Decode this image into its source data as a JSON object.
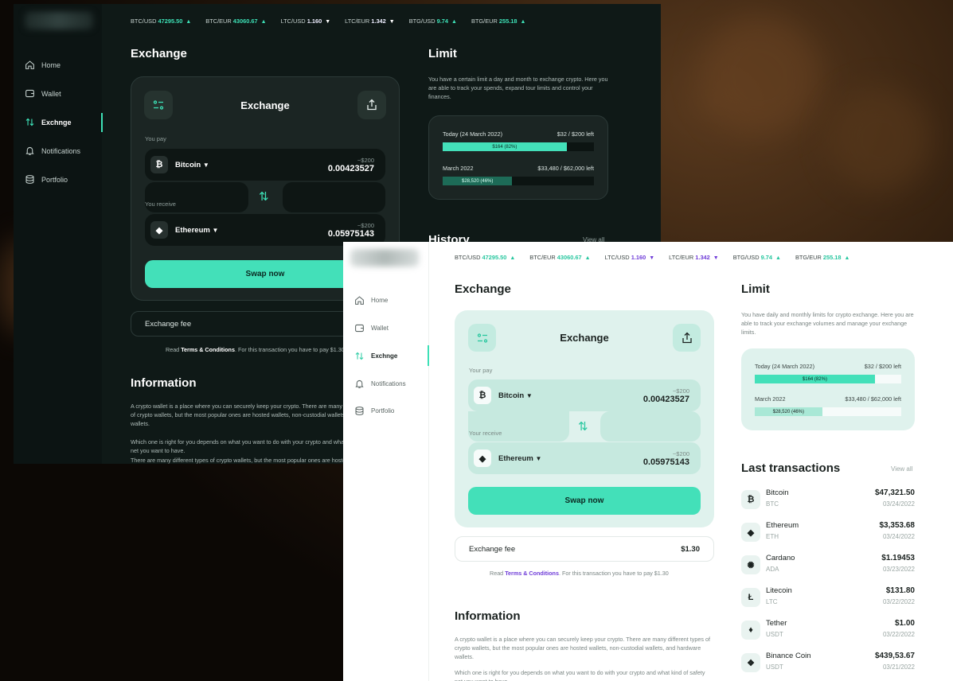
{
  "tickers": [
    {
      "pair": "BTC/USD",
      "value": "47295.50",
      "dir": "up"
    },
    {
      "pair": "BTC/EUR",
      "value": "43060.67",
      "dir": "up"
    },
    {
      "pair": "LTC/USD",
      "value": "1.160",
      "dir": "down"
    },
    {
      "pair": "LTC/EUR",
      "value": "1.342",
      "dir": "down"
    },
    {
      "pair": "BTG/USD",
      "value": "9.74",
      "dir": "up"
    },
    {
      "pair": "BTG/EUR",
      "value": "255.18",
      "dir": "up"
    }
  ],
  "nav": [
    {
      "label": "Home",
      "icon": "home-icon"
    },
    {
      "label": "Wallet",
      "icon": "wallet-icon"
    },
    {
      "label": "Exchnge",
      "icon": "exchange-arrows-icon",
      "active": true
    },
    {
      "label": "Notifications",
      "icon": "bell-icon"
    },
    {
      "label": "Portfolio",
      "icon": "database-icon"
    }
  ],
  "dark": {
    "exchange_heading": "Exchange",
    "card_title": "Exchange",
    "you_pay": "You pay",
    "you_receive": "You receive",
    "pay_coin": "Bitcoin",
    "pay_usd": "~$200",
    "pay_amount": "0.00423527",
    "recv_coin": "Ethereum",
    "recv_usd": "~$200",
    "recv_amount": "0.05975143",
    "swap_label": "Swap now",
    "fee_label": "Exchange fee",
    "terms_prefix": "Read",
    "terms_link": "Terms & Conditions",
    "terms_suffix": ". For this transaction you have to pay $1.30",
    "info_heading": "Information",
    "info_p1": "A crypto wallet is a place where you can securely keep your crypto. There are many different types of crypto wallets, but the most popular ones are hosted wallets, non-custodial wallets, and hardware wallets.",
    "info_p2": "Which one is right for you depends on what you want to do with your crypto and what kind of safety net you want to have.",
    "info_p3": "There are many different types of crypto wallets, but the most popular ones are hosted wallets,",
    "limit_heading": "Limit",
    "limit_text": "You have a certain limit a day and month to exchange crypto. Here you are able to track your spends, expand tour limits and control your finances.",
    "today_label": "Today (24 March 2022)",
    "today_left": "$32 / $200 left",
    "today_bar": "$164 (82%)",
    "today_pct": 0.82,
    "month_label": "March 2022",
    "month_left": "$33,480 / $62,000 left",
    "month_bar": "$28,520 (46%)",
    "month_pct": 0.46,
    "history_heading": "History",
    "history_view_all": "View all"
  },
  "light": {
    "exchange_heading": "Exchange",
    "card_title": "Exchange",
    "you_pay": "Your pay",
    "you_receive": "Your receive",
    "pay_coin": "Bitcoin",
    "pay_usd": "~$200",
    "pay_amount": "0.00423527",
    "recv_coin": "Ethereum",
    "recv_usd": "~$200",
    "recv_amount": "0.05975143",
    "swap_label": "Swap now",
    "fee_label": "Exchange fee",
    "fee_value": "$1.30",
    "terms_prefix": "Read",
    "terms_link": "Terms & Conditions",
    "terms_suffix": ". For this transaction you have to pay $1.30",
    "info_heading": "Information",
    "info_p1": "A crypto wallet is a place where you can securely keep your crypto. There are many different types of crypto wallets, but the most popular ones are hosted wallets, non-custodial wallets, and hardware wallets.",
    "info_p2": "Which one is right for you depends on what you want to do with your crypto and what kind of safety net you want to have.",
    "limit_heading": "Limit",
    "limit_text": "You have daily and monthly limits for crypto exchange. Here you are able to track your exchange volumes and manage your exchange limits.",
    "today_label": "Today (24 March 2022)",
    "today_left": "$32 / $200 left",
    "today_bar": "$164 (82%)",
    "today_pct": 0.82,
    "month_label": "March 2022",
    "month_left": "$33,480 / $62,000 left",
    "month_bar": "$28,520 (46%)",
    "month_pct": 0.46,
    "tx_heading": "Last transactions",
    "tx_view_all": "View all",
    "transactions": [
      {
        "name": "Bitcoin",
        "sym": "BTC",
        "amount": "$47,321.50",
        "date": "03/24/2022",
        "glyph": "₿",
        "icon": "bitcoin-icon"
      },
      {
        "name": "Ethereum",
        "sym": "ETH",
        "amount": "$3,353.68",
        "date": "03/24/2022",
        "glyph": "◆",
        "icon": "ethereum-icon"
      },
      {
        "name": "Cardano",
        "sym": "ADA",
        "amount": "$1.19453",
        "date": "03/23/2022",
        "glyph": "✺",
        "icon": "cardano-icon"
      },
      {
        "name": "Litecoin",
        "sym": "LTC",
        "amount": "$131.80",
        "date": "03/22/2022",
        "glyph": "Ł",
        "icon": "litecoin-icon"
      },
      {
        "name": "Tether",
        "sym": "USDT",
        "amount": "$1.00",
        "date": "03/22/2022",
        "glyph": "♦",
        "icon": "tether-icon"
      },
      {
        "name": "Binance Coin",
        "sym": "USDT",
        "amount": "$439,53.67",
        "date": "03/21/2022",
        "glyph": "❖",
        "icon": "binance-icon"
      }
    ]
  },
  "colors": {
    "accent": "#43e0b9",
    "dark_bg": "#0f1917",
    "light_card": "#dff2ed",
    "purple_down": "#6f3cd8"
  }
}
